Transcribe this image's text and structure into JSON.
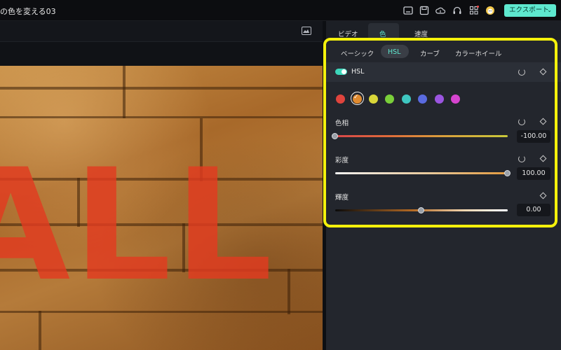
{
  "window": {
    "title": "の色を変える03"
  },
  "toolbar": {
    "export_label": "エクスポート",
    "export_chevron": "⌄"
  },
  "main_tabs": [
    {
      "label": "ビデオ",
      "active": false
    },
    {
      "label": "色",
      "active": true
    },
    {
      "label": "速度",
      "active": false
    }
  ],
  "sub_tabs": [
    {
      "label": "ベーシック",
      "active": false
    },
    {
      "label": "HSL",
      "active": true
    },
    {
      "label": "カーブ",
      "active": false
    },
    {
      "label": "カラーホイール",
      "active": false
    }
  ],
  "hsl_section": {
    "label": "HSL",
    "enabled": true
  },
  "swatches": [
    {
      "name": "red",
      "color": "#e0443d"
    },
    {
      "name": "orange",
      "color": "#e08a2f",
      "selected": true,
      "check": "✓"
    },
    {
      "name": "yellow",
      "color": "#d9d639"
    },
    {
      "name": "green",
      "color": "#7acf3a"
    },
    {
      "name": "aqua",
      "color": "#3ec6c0"
    },
    {
      "name": "blue",
      "color": "#5a6be0"
    },
    {
      "name": "purple",
      "color": "#9b55e0"
    },
    {
      "name": "magenta",
      "color": "#d644cf"
    }
  ],
  "params": {
    "hue": {
      "label": "色相",
      "value": "-100.00",
      "level": -100,
      "min": -100,
      "max": 100
    },
    "saturation": {
      "label": "彩度",
      "value": "100.00",
      "level": 100,
      "min": -100,
      "max": 100
    },
    "luminance": {
      "label": "輝度",
      "value": "0.00",
      "level": 0,
      "min": -100,
      "max": 100
    }
  },
  "preview": {
    "wall_text": "ALL"
  },
  "colors": {
    "accent": "#5ee8cf",
    "highlight": "#f4f10b",
    "panel": "#23262d"
  }
}
